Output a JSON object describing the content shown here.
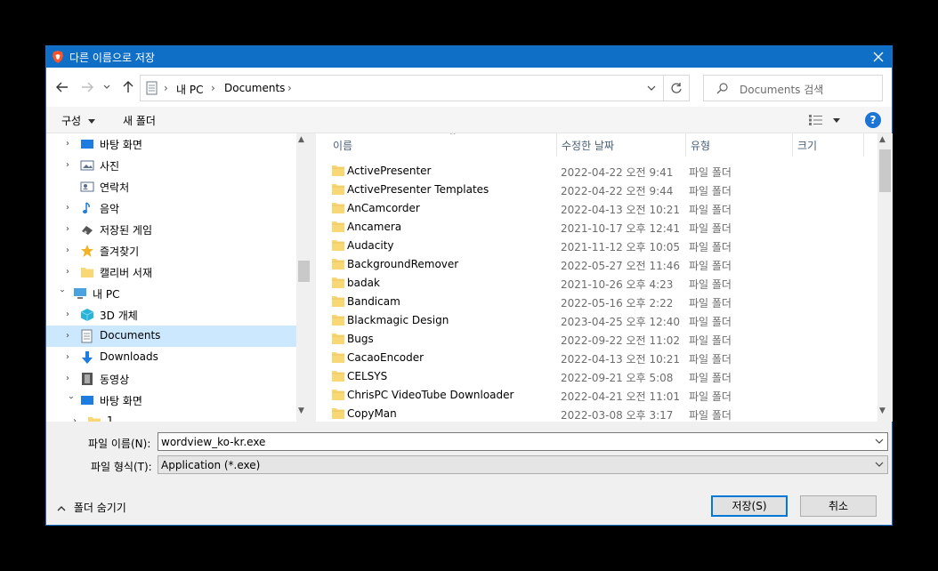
{
  "window": {
    "title": "다른 이름으로 저장"
  },
  "address": {
    "segments": [
      "내 PC",
      "Documents"
    ],
    "search_placeholder": "Documents 검색"
  },
  "toolbar": {
    "organize_label": "구성",
    "new_folder_label": "새 폴더",
    "help_label": "?"
  },
  "nav": {
    "items": [
      {
        "label": "바탕 화면",
        "icon": "desktop-icon",
        "color": "#1e7be0"
      },
      {
        "label": "사진",
        "icon": "pictures-icon",
        "color": "#5a6e8c"
      },
      {
        "label": "연락처",
        "icon": "contacts-icon",
        "color": "#5a6e8c"
      },
      {
        "label": "음악",
        "icon": "music-icon",
        "color": "#1e7be0"
      },
      {
        "label": "저장된 게임",
        "icon": "saved-games-icon",
        "color": "#555555"
      },
      {
        "label": "즐겨찾기",
        "icon": "favorites-icon",
        "color": "#f3b324"
      },
      {
        "label": "캘리버 서재",
        "icon": "folder-icon",
        "color": "#f8d775"
      },
      {
        "label": "내 PC",
        "icon": "this-pc-icon",
        "color": "#4aa3df"
      },
      {
        "label": "3D 개체",
        "icon": "3d-objects-icon",
        "color": "#28b4d8"
      },
      {
        "label": "Documents",
        "icon": "documents-icon",
        "color": "#6e7a8a"
      },
      {
        "label": "Downloads",
        "icon": "downloads-icon",
        "color": "#1e7be0"
      },
      {
        "label": "동영상",
        "icon": "videos-icon",
        "color": "#555555"
      },
      {
        "label": "바탕 화면",
        "icon": "desktop-icon",
        "color": "#1e7be0"
      },
      {
        "label": "1",
        "icon": "folder-icon",
        "color": "#f8d775"
      }
    ]
  },
  "columns": {
    "name": "이름",
    "modified": "수정한 날짜",
    "type": "유형",
    "size": "크기"
  },
  "files": [
    {
      "name": "ActivePresenter",
      "date": "2022-04-22 오전 9:41",
      "type": "파일 폴더"
    },
    {
      "name": "ActivePresenter Templates",
      "date": "2022-04-22 오전 9:44",
      "type": "파일 폴더"
    },
    {
      "name": "AnCamcorder",
      "date": "2022-04-13 오전 10:21",
      "type": "파일 폴더"
    },
    {
      "name": "Ancamera",
      "date": "2021-10-17 오후 12:41",
      "type": "파일 폴더"
    },
    {
      "name": "Audacity",
      "date": "2021-11-12 오후 10:05",
      "type": "파일 폴더"
    },
    {
      "name": "BackgroundRemover",
      "date": "2022-05-27 오전 11:46",
      "type": "파일 폴더"
    },
    {
      "name": "badak",
      "date": "2021-10-26 오후 4:23",
      "type": "파일 폴더"
    },
    {
      "name": "Bandicam",
      "date": "2022-05-16 오후 2:22",
      "type": "파일 폴더"
    },
    {
      "name": "Blackmagic Design",
      "date": "2023-04-25 오후 12:40",
      "type": "파일 폴더"
    },
    {
      "name": "Bugs",
      "date": "2022-09-22 오전 11:02",
      "type": "파일 폴더"
    },
    {
      "name": "CacaoEncoder",
      "date": "2022-04-13 오전 10:21",
      "type": "파일 폴더"
    },
    {
      "name": "CELSYS",
      "date": "2022-09-21 오후 5:08",
      "type": "파일 폴더"
    },
    {
      "name": "ChrisPC VideoTube Downloader",
      "date": "2022-04-21 오전 11:01",
      "type": "파일 폴더"
    },
    {
      "name": "CopyMan",
      "date": "2022-03-08 오후 3:17",
      "type": "파일 폴더"
    }
  ],
  "form": {
    "filename_label": "파일 이름(N):",
    "filename_value": "wordview_ko-kr.exe",
    "filetype_label": "파일 형식(T):",
    "filetype_value": "Application (*.exe)"
  },
  "footer": {
    "hide_folders_label": "폴더 숨기기",
    "save_label": "저장(S)",
    "cancel_label": "취소"
  },
  "colors": {
    "titlebar": "#0f6fc6",
    "selection": "#cce8ff",
    "folder": "#f8d775",
    "accent": "#0078d7"
  }
}
